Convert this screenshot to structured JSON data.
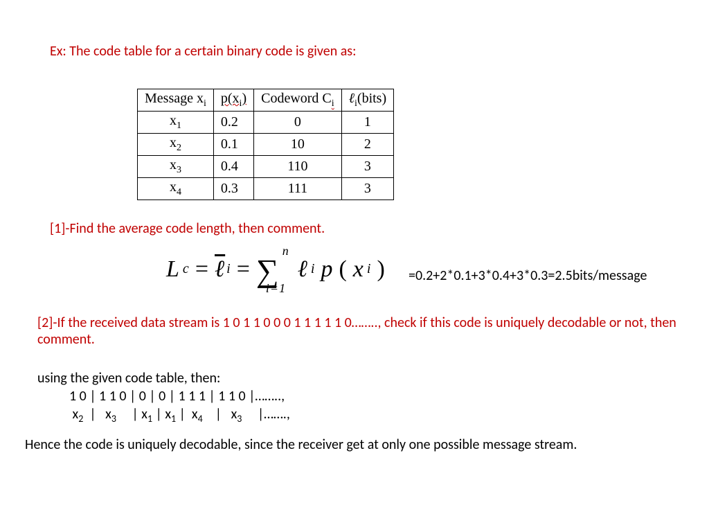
{
  "title": "Ex:  The code table for a certain binary code is given as:",
  "table": {
    "headers": {
      "message": "Message  x",
      "message_sub": "i",
      "prob": "p(x",
      "prob_sub": "i",
      "prob_close": ")",
      "codeword": "Codeword C",
      "codeword_sub": "i",
      "length": "ℓ",
      "length_sub": "i",
      "length_tail": "(bits)"
    },
    "rows": [
      {
        "msg": "x",
        "msg_sub": "1",
        "p": "0.2",
        "cw": "0",
        "len": "1"
      },
      {
        "msg": "x",
        "msg_sub": "2",
        "p": "0.1",
        "cw": "10",
        "len": "2"
      },
      {
        "msg": "x",
        "msg_sub": "3",
        "p": "0.4",
        "cw": "110",
        "len": "3"
      },
      {
        "msg": "x",
        "msg_sub": "4",
        "p": "0.3",
        "cw": "111",
        "len": "3"
      }
    ]
  },
  "q1": "[1]-Find the average code length, then comment.",
  "formula_calc": "=0.2+2*0.1+3*0.4+3*0.3=2.5bits/message",
  "q2": "[2]-If the received data stream is 1 0 1 1 0 0 0 1 1 1 1 1 0…….., check if this code is uniquely decodable or not, then comment.",
  "solve_intro": "using the given code table, then:",
  "bits_line": "1 0 | 1 1 0 | 0 | 0 | 1 1 1 | 1 1 0 |……..,",
  "syms_prefix_spaces": " ",
  "syms": {
    "a": "x",
    "a_sub": "2",
    "b": "x",
    "b_sub": "3",
    "c": "x",
    "c_sub": "1",
    "d": "x",
    "d_sub": "1",
    "e": "x",
    "e_sub": "4",
    "f": "x",
    "f_sub": "3",
    "tail": "|…….,"
  },
  "conclusion": "Hence the code is uniquely decodable, since the receiver get at only one possible message stream."
}
